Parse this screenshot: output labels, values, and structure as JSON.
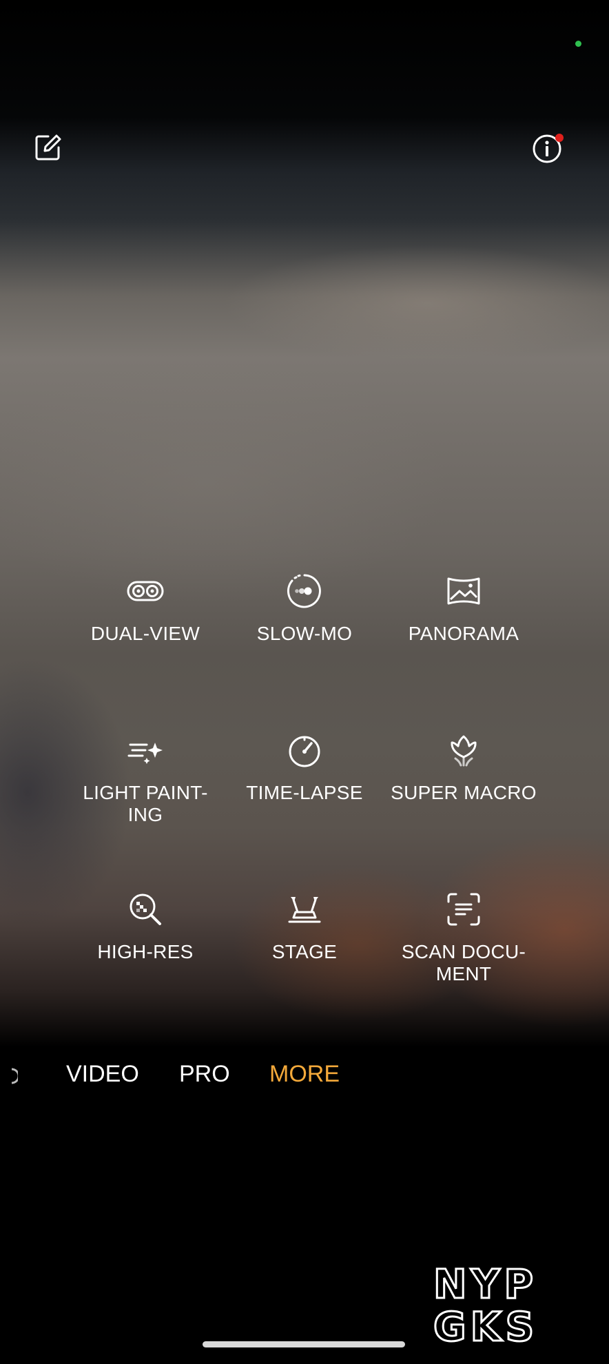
{
  "modes": {
    "dual_view": {
      "label": "DUAL-VIEW",
      "icon": "dual-view-icon"
    },
    "slow_mo": {
      "label": "SLOW-MO",
      "icon": "slow-mo-icon"
    },
    "panorama": {
      "label": "PANORAMA",
      "icon": "panorama-icon"
    },
    "light_painting": {
      "label": "LIGHT PAINT-\nING",
      "icon": "light-painting-icon"
    },
    "time_lapse": {
      "label": "TIME-LAPSE",
      "icon": "time-lapse-icon"
    },
    "super_macro": {
      "label": "SUPER MACRO",
      "icon": "super-macro-icon"
    },
    "high_res": {
      "label": "HIGH-RES",
      "icon": "high-res-icon"
    },
    "stage": {
      "label": "STAGE",
      "icon": "stage-icon"
    },
    "scan_document": {
      "label": "SCAN DOCU-\nMENT",
      "icon": "scan-document-icon"
    }
  },
  "tabs": {
    "video": "VIDEO",
    "pro": "PRO",
    "more": "MORE",
    "active": "more"
  },
  "topbar": {
    "edit_icon": "edit-icon",
    "info_icon": "info-icon",
    "info_badge_color": "#e0201c"
  },
  "watermark": {
    "line1": "NYP",
    "line2": "GKS"
  },
  "colors": {
    "accent": "#f4a93a",
    "status_dot": "#2fbf4f"
  }
}
